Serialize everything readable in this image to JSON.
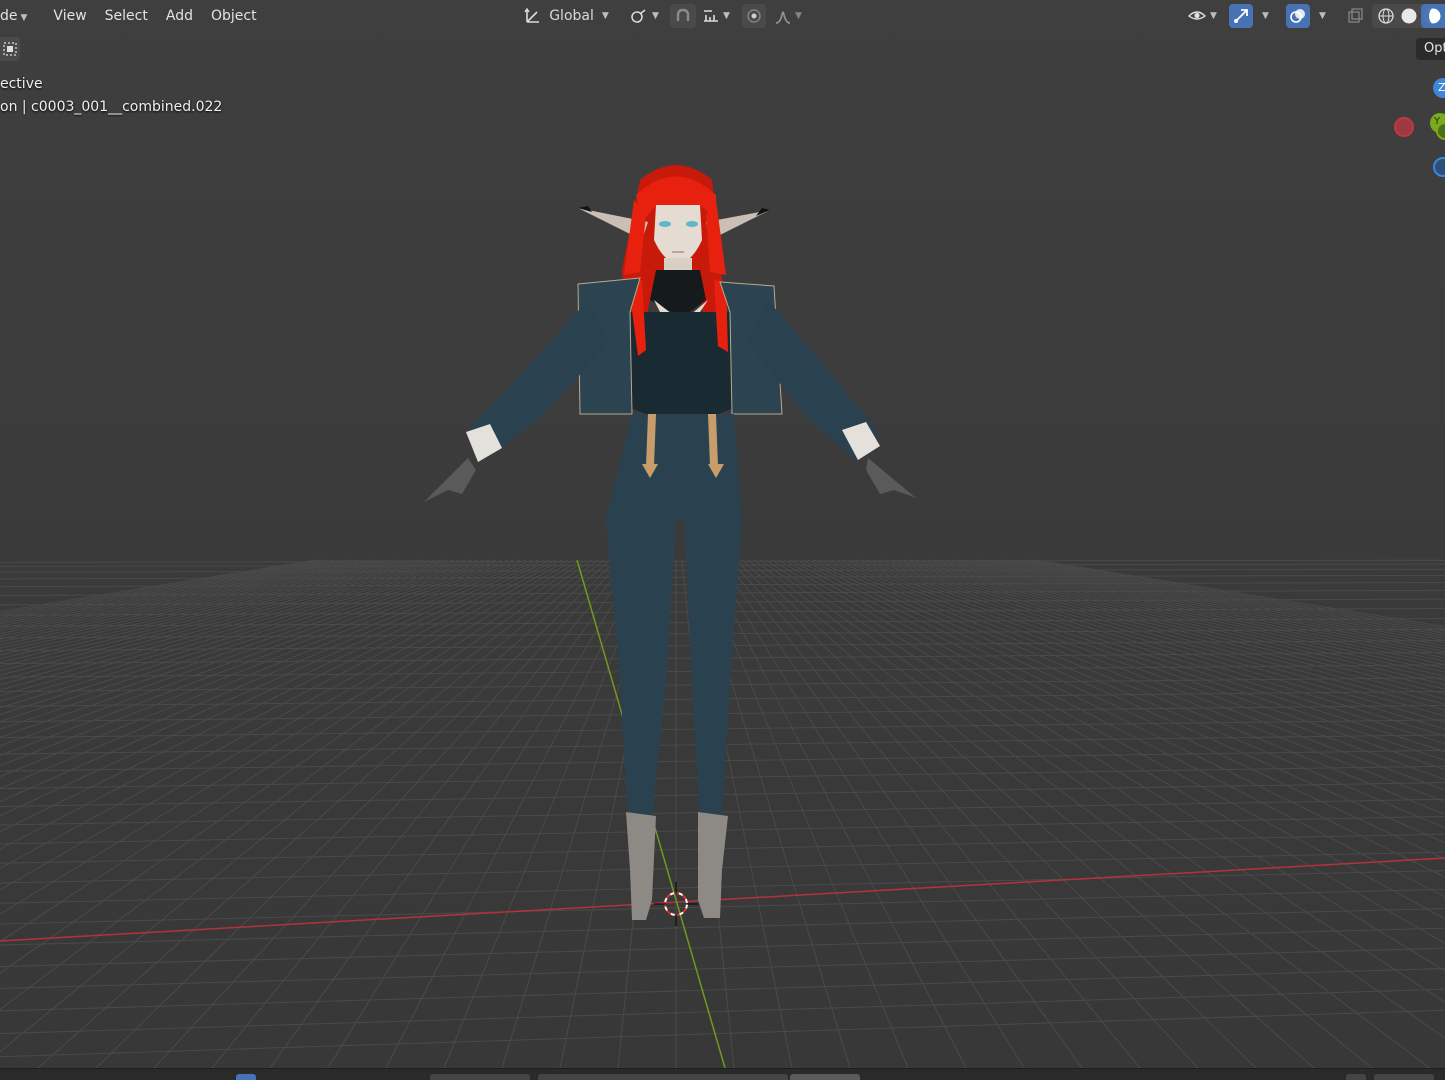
{
  "header": {
    "mode_label": "de",
    "menus": [
      "View",
      "Select",
      "Add",
      "Object"
    ],
    "transform_orientation": "Global",
    "options_label": "Opt"
  },
  "overlay": {
    "view_name": "ective",
    "object_info": "on | c0003_001__combined.022"
  },
  "gizmo": {
    "axis_z_label": "Z",
    "axis_y_label": "Y",
    "colors": {
      "x": "#d2383f",
      "y": "#7aab1d",
      "z": "#3d86d9"
    }
  },
  "icons": [
    "transform-orientation-icon",
    "snap-link-icon",
    "snap-magnet-icon",
    "snap-increment-icon",
    "proportional-edit-icon",
    "falloff-curve-icon",
    "visibility-eye-icon",
    "gizmo-arrow-icon",
    "overlay-circles-icon",
    "xray-icon",
    "wireframe-shading-icon",
    "solid-shading-icon",
    "material-shading-icon",
    "select-box-icon",
    "3d-cursor-icon"
  ],
  "colors": {
    "header_active": "#4772b3",
    "x_axis_line": "#b3333c",
    "y_axis_line": "#6f9a1f",
    "hair": "#e8210f",
    "outfit": "#243b46"
  }
}
